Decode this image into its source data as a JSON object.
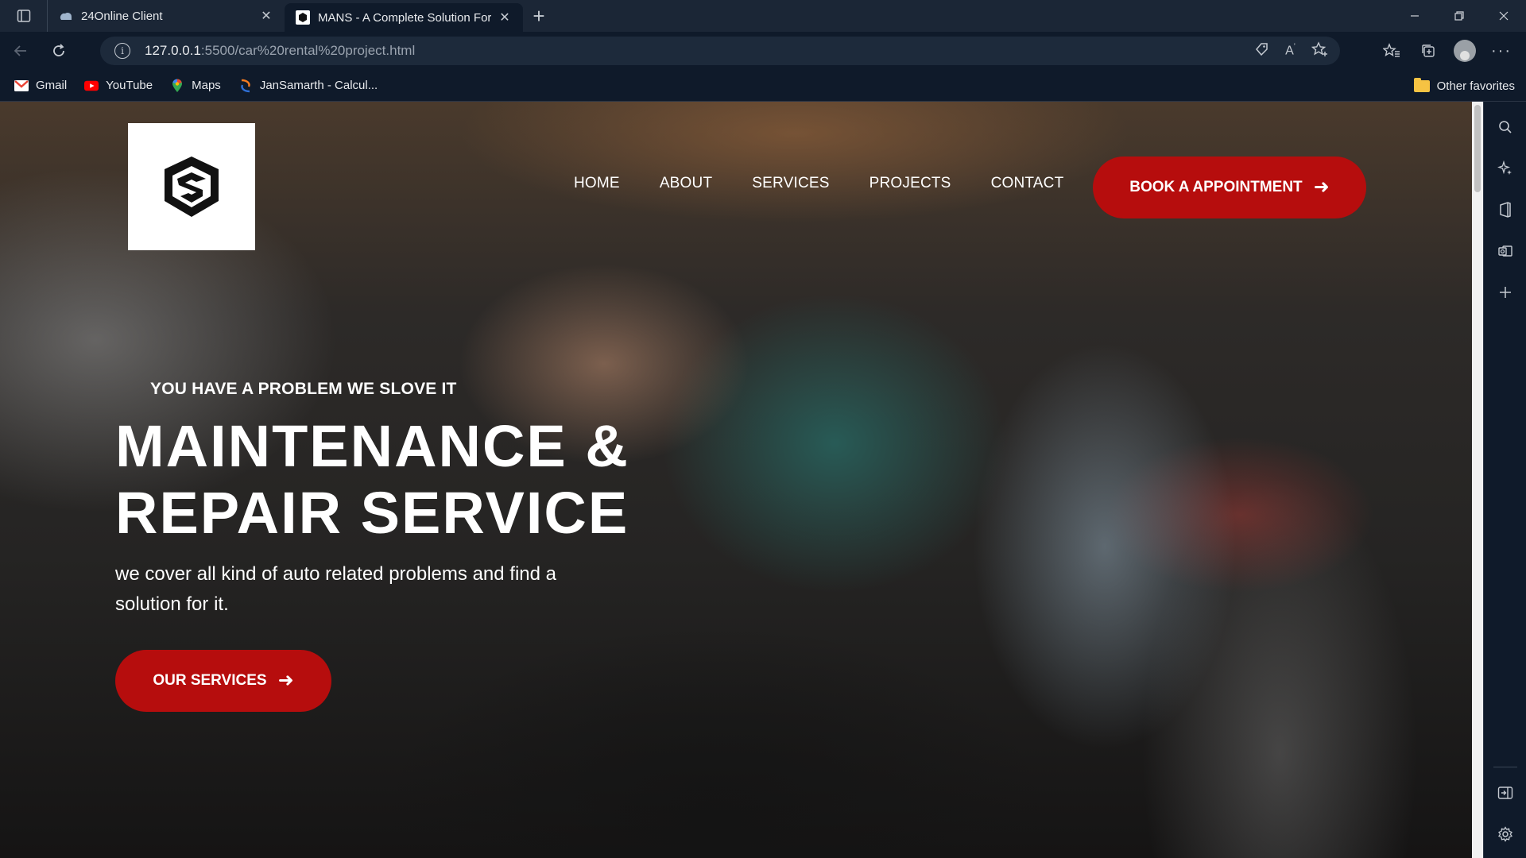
{
  "browser": {
    "tabs": [
      {
        "title": "24Online Client",
        "active": false
      },
      {
        "title": "MANS - A Complete Solution For",
        "active": true
      }
    ],
    "new_tab": "+",
    "url_host": "127.0.0.1",
    "url_path": ":5500/car%20rental%20project.html",
    "bookmarks": [
      {
        "label": "Gmail",
        "icon": "gmail-icon"
      },
      {
        "label": "YouTube",
        "icon": "youtube-icon"
      },
      {
        "label": "Maps",
        "icon": "maps-icon"
      },
      {
        "label": "JanSamarth - Calcul...",
        "icon": "jansamarth-icon"
      }
    ],
    "other_favorites": "Other favorites"
  },
  "site": {
    "nav": [
      "HOME",
      "ABOUT",
      "SERVICES",
      "PROJECTS",
      "CONTACT"
    ],
    "cta_button": "BOOK A APPOINTMENT",
    "kicker": "YOU HAVE A PROBLEM WE SLOVE IT",
    "headline_line1": "MAINTENANCE &",
    "headline_line2": "REPAIR SERVICE",
    "subline": "we cover all kind of auto related problems and find a solution for it.",
    "services_button": "OUR SERVICES",
    "accent_color": "#b60d0d"
  }
}
